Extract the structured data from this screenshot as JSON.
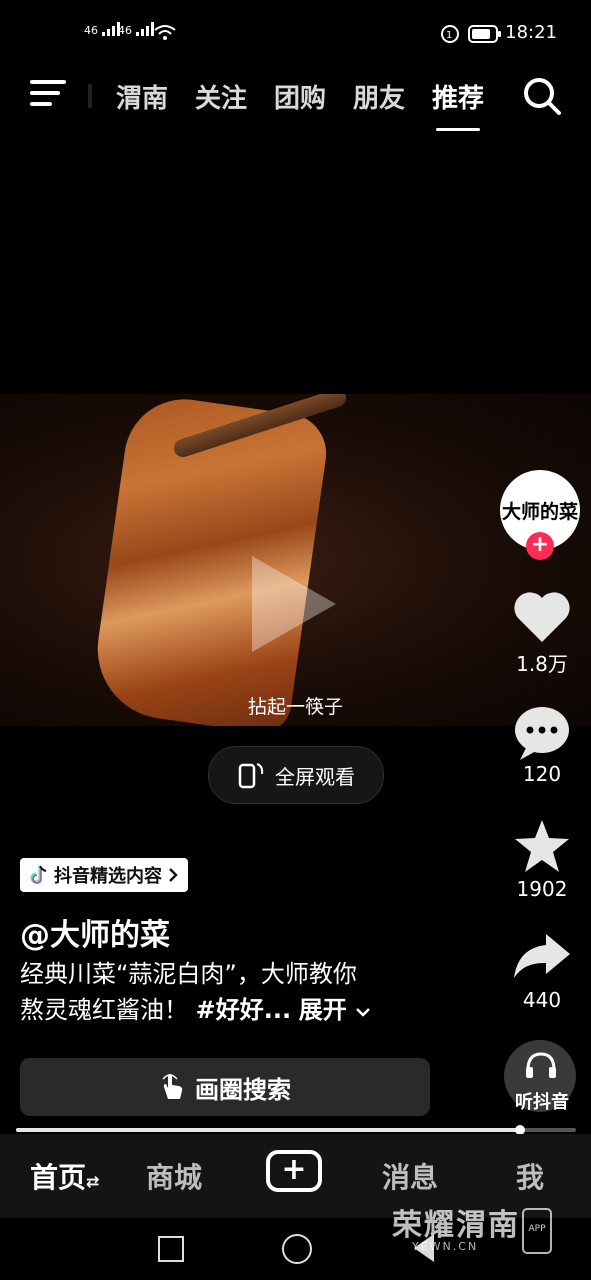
{
  "status_bar": {
    "signal_1": "46",
    "signal_2": "46",
    "time": "18:21"
  },
  "top_nav": {
    "tabs": [
      {
        "label": "渭南",
        "active": false
      },
      {
        "label": "关注",
        "active": false
      },
      {
        "label": "团购",
        "active": false
      },
      {
        "label": "朋友",
        "active": false
      },
      {
        "label": "推荐",
        "active": true
      }
    ]
  },
  "video": {
    "subtitle": "拈起一筷子"
  },
  "fullscreen_button": {
    "label": "全屏观看"
  },
  "right_rail": {
    "avatar_text": "大师的菜",
    "likes": "1.8万",
    "comments": "120",
    "favorites": "1902",
    "shares": "440",
    "listen_label": "听抖音"
  },
  "post": {
    "badge": "抖音精选内容",
    "author": "@大师的菜",
    "desc_line1": "经典川菜“蒜泥白肉”，大师教你",
    "desc_line2_text": "熬灵魂红酱油！",
    "desc_hashtag": "#好好...",
    "expand_label": "展开"
  },
  "search_bar": {
    "label": "画圈搜索"
  },
  "progress": {
    "fraction": 0.9
  },
  "bottom_nav": {
    "items": [
      {
        "label": "首页",
        "active": true
      },
      {
        "label": "商城",
        "active": false
      },
      {
        "label": "消息",
        "active": false
      },
      {
        "label": "我",
        "active": false
      }
    ]
  },
  "watermark": {
    "title": "荣耀渭南",
    "url": "YEWN.CN",
    "app": "APP"
  },
  "icons": {
    "menu": "menu-icon",
    "search": "search-icon",
    "play": "play-icon",
    "heart": "heart-icon",
    "comment": "comment-icon",
    "star": "star-icon",
    "share": "share-icon",
    "headphones": "headphones-icon",
    "plus": "plus-icon"
  },
  "colors": {
    "follow": "#fe2c55",
    "background": "#000000"
  }
}
